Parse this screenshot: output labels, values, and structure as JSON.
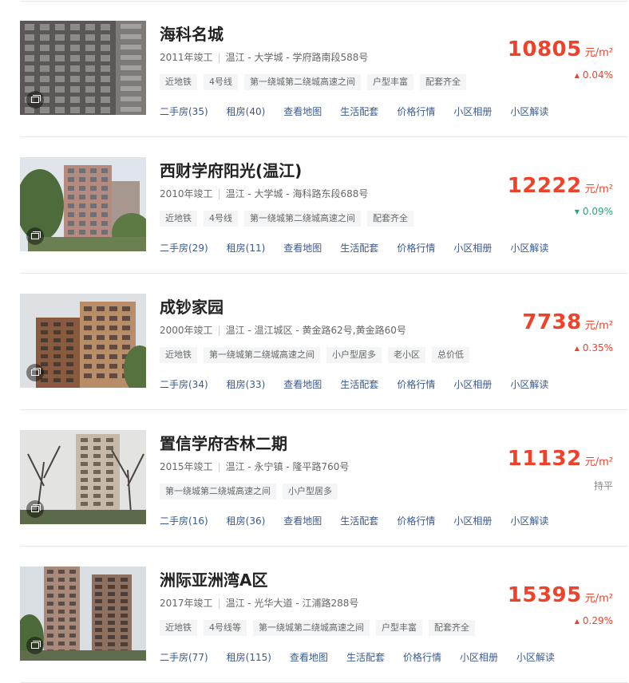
{
  "listings": [
    {
      "name": "海科名城",
      "year": "2011年竣工",
      "location": "温江 - 大学城 - 学府路南段588号",
      "tags": [
        "近地铁",
        "4号线",
        "第一绕城第二绕城高速之间",
        "户型丰富",
        "配套齐全"
      ],
      "links": [
        "二手房(35)",
        "租房(40)",
        "查看地图",
        "生活配套",
        "价格行情",
        "小区相册",
        "小区解读"
      ],
      "price": "10805",
      "unit": "元/m²",
      "change": "0.04%",
      "trend": "up",
      "arrow_icon": "triangle-up-icon"
    },
    {
      "name": "西财学府阳光(温江)",
      "year": "2010年竣工",
      "location": "温江 - 大学城 - 海科路东段688号",
      "tags": [
        "近地铁",
        "4号线",
        "第一绕城第二绕城高速之间",
        "配套齐全"
      ],
      "links": [
        "二手房(29)",
        "租房(11)",
        "查看地图",
        "生活配套",
        "价格行情",
        "小区相册",
        "小区解读"
      ],
      "price": "12222",
      "unit": "元/m²",
      "change": "0.09%",
      "trend": "down",
      "arrow_icon": "triangle-down-icon"
    },
    {
      "name": "成钞家园",
      "year": "2000年竣工",
      "location": "温江 - 温江城区 - 黄金路62号,黄金路60号",
      "tags": [
        "近地铁",
        "第一绕城第二绕城高速之间",
        "小户型居多",
        "老小区",
        "总价低"
      ],
      "links": [
        "二手房(34)",
        "租房(33)",
        "查看地图",
        "生活配套",
        "价格行情",
        "小区相册",
        "小区解读"
      ],
      "price": "7738",
      "unit": "元/m²",
      "change": "0.35%",
      "trend": "up",
      "arrow_icon": "triangle-up-icon"
    },
    {
      "name": "置信学府杏林二期",
      "year": "2015年竣工",
      "location": "温江 - 永宁镇 - 隆平路760号",
      "tags": [
        "第一绕城第二绕城高速之间",
        "小户型居多"
      ],
      "links": [
        "二手房(16)",
        "租房(36)",
        "查看地图",
        "生活配套",
        "价格行情",
        "小区相册",
        "小区解读"
      ],
      "price": "11132",
      "unit": "元/m²",
      "change": "持平",
      "trend": "flat",
      "arrow_icon": ""
    },
    {
      "name": "洲际亚洲湾A区",
      "year": "2017年竣工",
      "location": "温江 - 光华大道 - 江浦路288号",
      "tags": [
        "近地铁",
        "4号线等",
        "第一绕城第二绕城高速之间",
        "户型丰富",
        "配套齐全"
      ],
      "links": [
        "二手房(77)",
        "租房(115)",
        "查看地图",
        "生活配套",
        "价格行情",
        "小区相册",
        "小区解读"
      ],
      "price": "15395",
      "unit": "元/m²",
      "change": "0.29%",
      "trend": "up",
      "arrow_icon": "triangle-up-icon"
    }
  ],
  "colors": {
    "price": "#f0412a",
    "down": "#2aa67a",
    "link": "#3a5a8f"
  }
}
